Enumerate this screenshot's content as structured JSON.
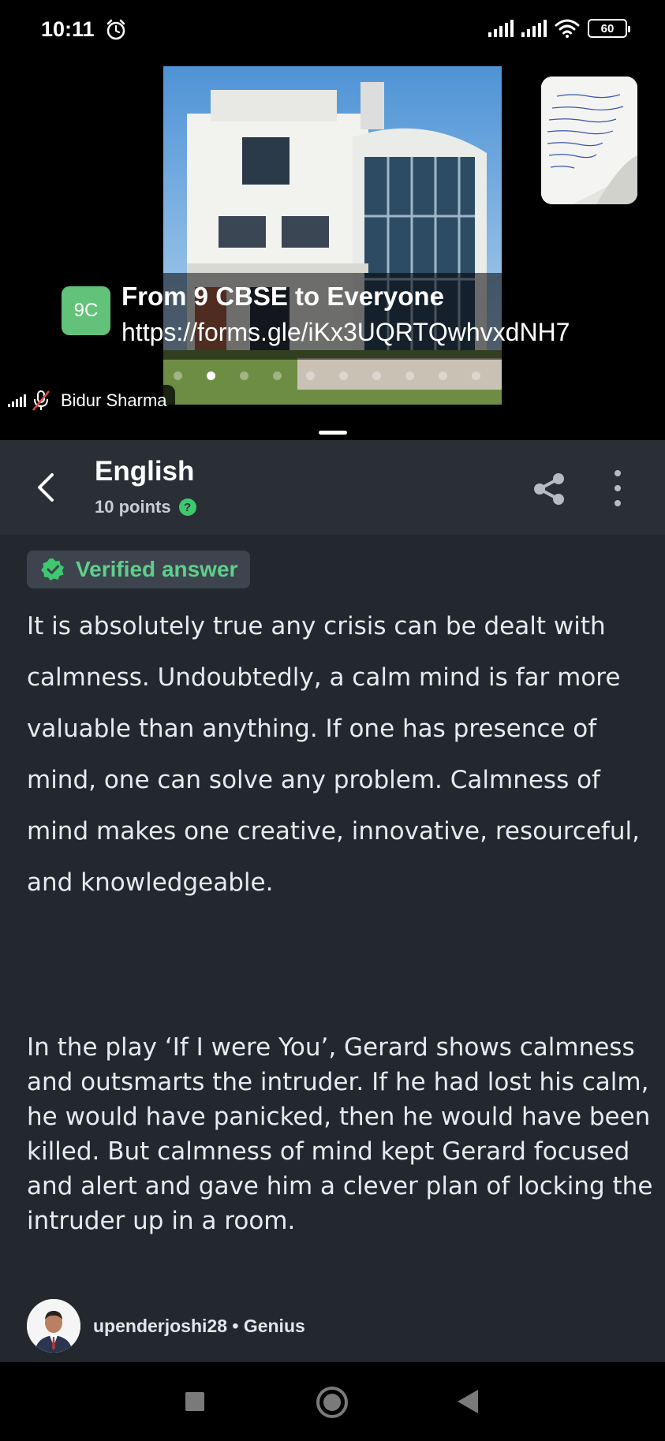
{
  "status_bar": {
    "time": "10:11",
    "battery": "60"
  },
  "video_call": {
    "notification": {
      "avatar_initials": "9C",
      "title": "From 9 CBSE to Everyone",
      "link": "https://forms.gle/iKx3UQRTQwhvxdNH7"
    },
    "participant_name": "Bidur Sharma"
  },
  "header": {
    "subject": "English",
    "points": "10 points",
    "help_icon_text": "?"
  },
  "answer": {
    "badge": "Verified answer",
    "paragraph_1": "It is absolutely true any crisis can be dealt with calmness. Undoubtedly, a calm mind is far more valuable than anything. If one has presence of mind, one can solve any problem. Calmness of mind makes one creative, innovative, resourceful, and knowledgeable.",
    "paragraph_2": "In the play ‘If I were You’, Gerard shows calmness and outsmarts the intruder. If he had lost his calm, he would have panicked, then he would have been killed. But calmness of mind kept Gerard focused and alert and gave him a clever plan of locking the intruder up in a room.",
    "author": "upenderjoshi28 • Genius"
  },
  "colors": {
    "header_bg": "#2a2f36",
    "content_bg": "#23282e",
    "accent_green": "#5fcf8b",
    "avatar_green": "#62c27a"
  },
  "icons": {
    "status": [
      "alarm-icon",
      "signal-icon",
      "wifi-icon",
      "battery-icon"
    ],
    "header": [
      "back-arrow-icon",
      "share-icon",
      "more-vertical-icon",
      "help-icon"
    ],
    "nav": [
      "recents-icon",
      "home-icon",
      "back-icon"
    ]
  }
}
